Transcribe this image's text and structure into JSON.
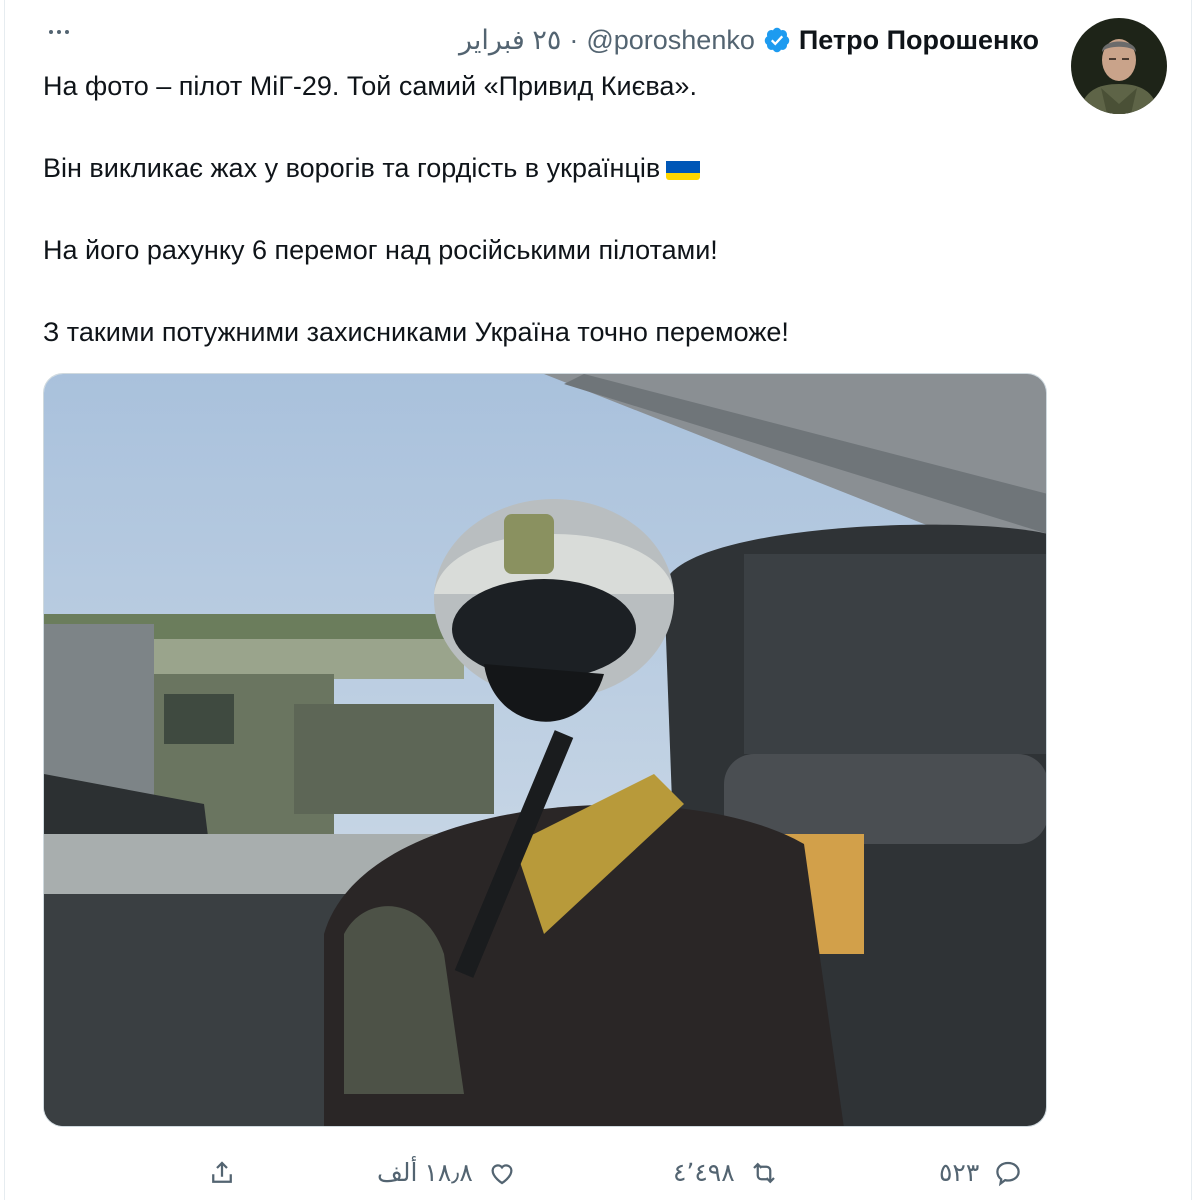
{
  "tweet": {
    "author_name": "Петро Порошенко",
    "handle": "@poroshenko",
    "separator": "·",
    "date": "٢٥ فبراير",
    "paragraphs": [
      "На фото – пілот МіГ-29. Той самий «Привид Києва».",
      "Він викликає жах у ворогів та гордість в українців",
      "На його рахунку 6 перемог над російськими пілотами!",
      "З такими потужними захисниками Україна точно переможе!"
    ],
    "flag_icon": "ukraine-flag-emoji",
    "flag_colors": {
      "top": "#0057b7",
      "bottom": "#ffd700"
    },
    "verified_color": "#1d9bf0"
  },
  "actions": {
    "reply_count": "٥٢٣",
    "retweet_count": "٤٬٤٩٨",
    "like_count": "١٨٫٨ ألف",
    "icons": [
      "reply-icon",
      "retweet-icon",
      "like-icon",
      "share-icon"
    ]
  }
}
